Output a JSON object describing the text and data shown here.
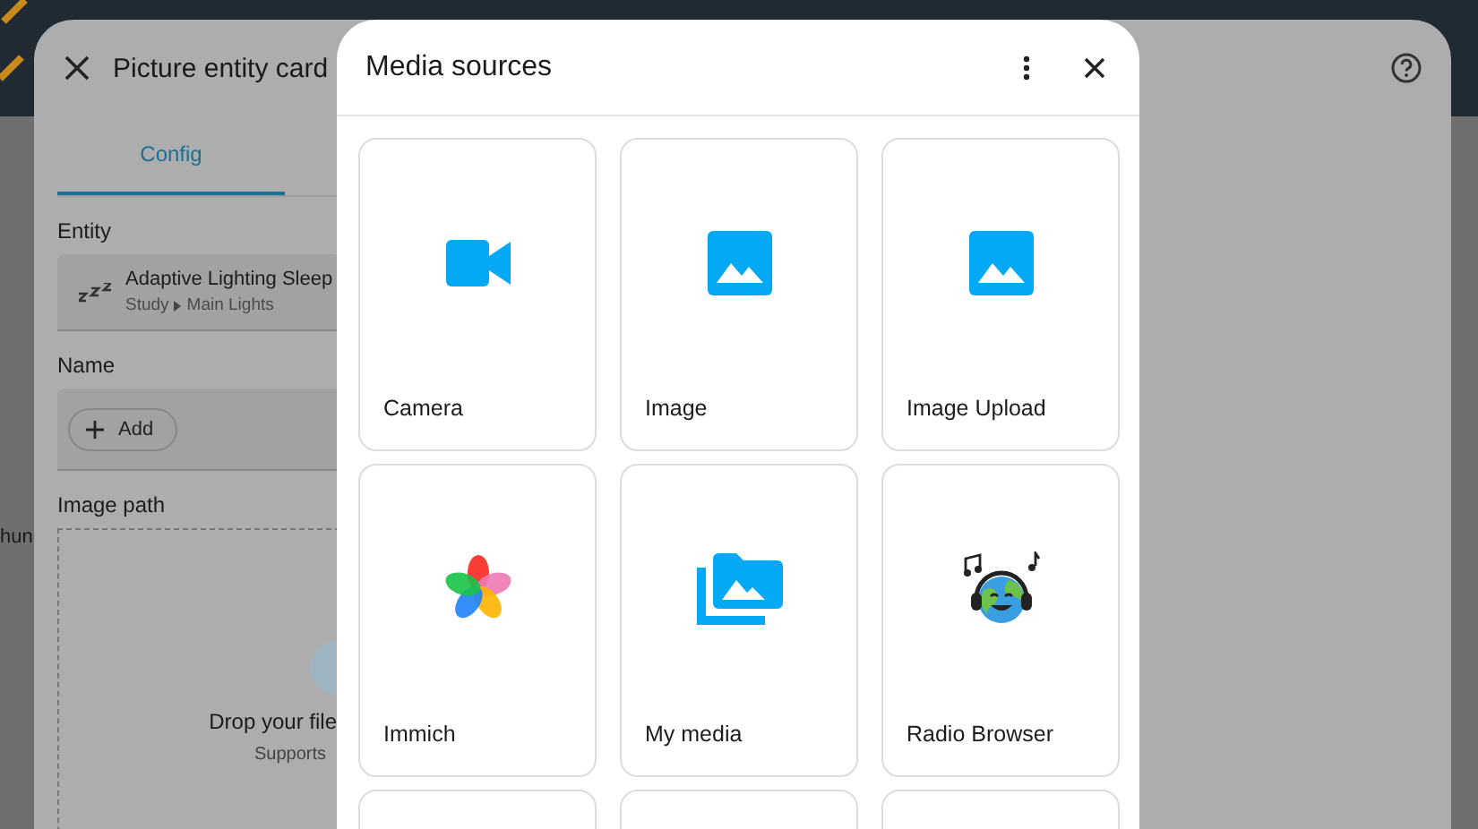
{
  "background": {
    "partial_text": "hun"
  },
  "editor": {
    "title": "Picture entity card",
    "tabs": [
      {
        "label": "Config",
        "selected": true
      }
    ],
    "entity": {
      "label": "Entity",
      "name": "Adaptive Lighting Sleep",
      "path": [
        "Study",
        "Main Lights"
      ]
    },
    "name_field": {
      "label": "Name",
      "add_button": "Add"
    },
    "image_path": {
      "label": "Image path",
      "drop_text": "Drop your file",
      "supports_text": "Supports"
    }
  },
  "media_dialog": {
    "title": "Media sources",
    "sources": [
      {
        "label": "Camera"
      },
      {
        "label": "Image"
      },
      {
        "label": "Image Upload"
      },
      {
        "label": "Immich"
      },
      {
        "label": "My media"
      },
      {
        "label": "Radio Browser"
      }
    ]
  }
}
